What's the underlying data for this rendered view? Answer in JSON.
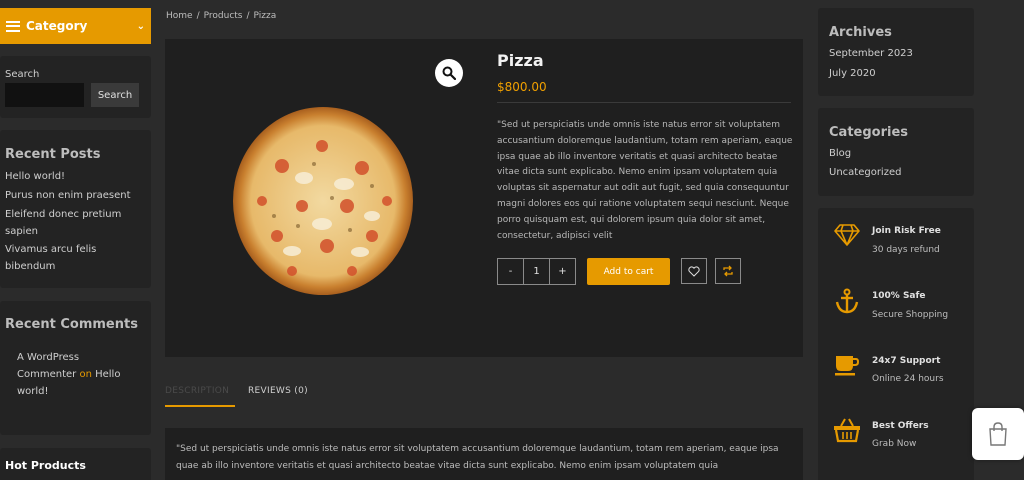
{
  "category_bar": {
    "label": "Category"
  },
  "search": {
    "label": "Search",
    "button": "Search",
    "placeholder": ""
  },
  "recent_posts": {
    "title": "Recent Posts",
    "items": [
      "Hello world!",
      "Purus non enim praesent",
      "Eleifend donec pretium sapien",
      "Vivamus arcu felis bibendum"
    ]
  },
  "recent_comments": {
    "title": "Recent Comments",
    "author": "A WordPress Commenter",
    "on": "on",
    "post": "Hello world!"
  },
  "hot_products": {
    "title": "Hot Products"
  },
  "breadcrumb": {
    "home": "Home",
    "products": "Products",
    "current": "Pizza",
    "sep": "/"
  },
  "product": {
    "title": "Pizza",
    "price": "$800.00",
    "description": "\"Sed ut perspiciatis unde omnis iste natus error sit voluptatem accusantium doloremque laudantium, totam rem aperiam, eaque ipsa quae ab illo inventore veritatis et quasi architecto beatae vitae dicta sunt explicabo. Nemo enim ipsam voluptatem quia voluptas sit aspernatur aut odit aut fugit, sed quia consequuntur magni dolores eos qui ratione voluptatem sequi nesciunt. Neque porro quisquam est, qui dolorem ipsum quia dolor sit amet, consectetur, adipisci velit",
    "qty_minus": "-",
    "qty_value": "1",
    "qty_plus": "+",
    "add_to_cart": "Add to cart"
  },
  "tabs": {
    "description": "DESCRIPTION",
    "reviews": "REVIEWS (0)"
  },
  "tab_content": "\"Sed ut perspiciatis unde omnis iste natus error sit voluptatem accusantium doloremque laudantium, totam rem aperiam, eaque ipsa quae ab illo inventore veritatis et quasi architecto beatae vitae dicta sunt explicabo. Nemo enim ipsam voluptatem quia",
  "archives": {
    "title": "Archives",
    "items": [
      "September 2023",
      "July 2020"
    ]
  },
  "categories": {
    "title": "Categories",
    "items": [
      "Blog",
      "Uncategorized"
    ]
  },
  "features": [
    {
      "icon": "diamond-icon",
      "title": "Join Risk Free",
      "sub": "30 days refund"
    },
    {
      "icon": "anchor-icon",
      "title": "100% Safe",
      "sub": "Secure Shopping"
    },
    {
      "icon": "cup-icon",
      "title": "24x7 Support",
      "sub": "Online 24 hours"
    },
    {
      "icon": "basket-icon",
      "title": "Best Offers",
      "sub": "Grab Now"
    }
  ],
  "colors": {
    "accent": "#e69a00",
    "background": "#2b2b2b",
    "panel": "#232323"
  }
}
